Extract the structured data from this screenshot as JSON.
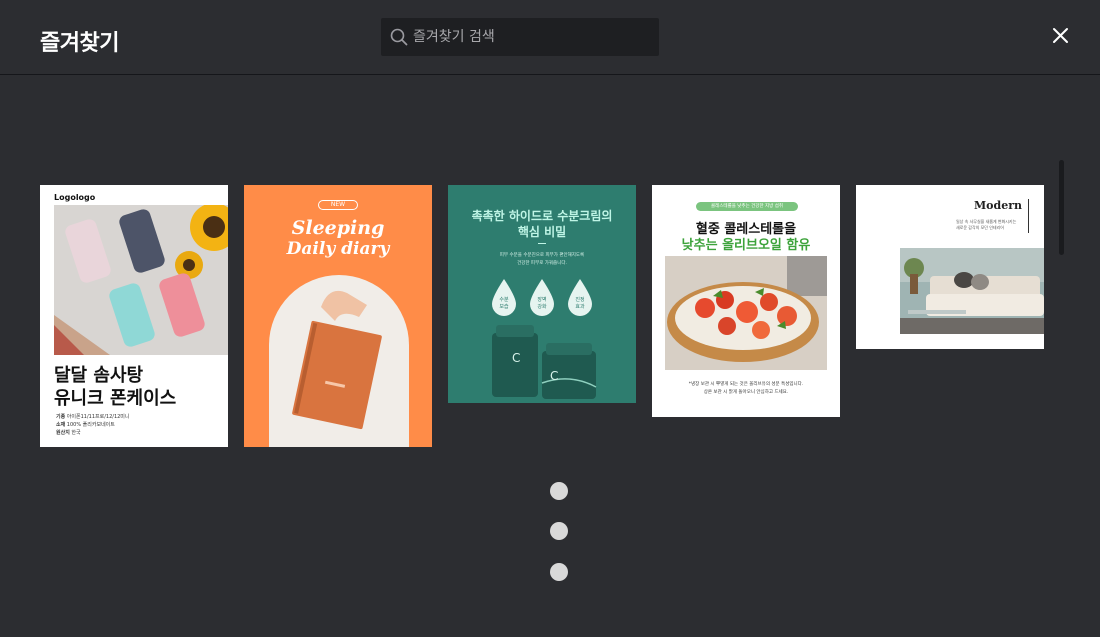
{
  "header": {
    "title": "즐겨찾기",
    "search_placeholder": "즐겨찾기 검색"
  },
  "icons": {
    "search": "search-icon",
    "close": "close-icon",
    "more": "more-vertical-icon"
  },
  "cards": [
    {
      "logo": "Logologo",
      "headline_line1": "달달 솜사탕",
      "headline_line2": "유니크 폰케이스",
      "spec1_label": "기종",
      "spec1_value": "아이폰11/11프로/12/12미니",
      "spec2_label": "소재",
      "spec2_value": "100% 폴리카보네이트",
      "spec3_label": "원산지",
      "spec3_value": "한국"
    },
    {
      "badge": "NEW",
      "title_line1": "Sleeping",
      "title_line2": "Daily diary"
    },
    {
      "headline_line1": "촉촉한 하이드로 수분크림의",
      "headline_line2": "핵심 비밀",
      "body_line1": "피부 수분을 수분진으로 피부가 편안해지도록",
      "body_line2": "건강한 피부로 가꿔줍니다.",
      "drops": [
        {
          "line1": "수분",
          "line2": "보습"
        },
        {
          "line1": "장벽",
          "line2": "강화"
        },
        {
          "line1": "진정",
          "line2": "효과"
        }
      ],
      "jar_letter": "C"
    },
    {
      "tag": "콜레스테롤을 낮추는 건강한 지방 섭취",
      "headline_line1": "혈중 콜레스테롤을",
      "headline_line2": "낮추는 올리브오일 함유",
      "body_line1": "*냉장 보관 시 뿌옇게 되는 것은 올리브유의 성분 특성입니다.",
      "body_line2": "상온 보관 시 맑게 돌아오니 안심하고 드세요."
    },
    {
      "title": "Modern",
      "body_line1": "일상 속 사무실을 새롭게 변화시키는",
      "body_line2": "새로운 감각의 모던 인테리어"
    }
  ],
  "colors": {
    "background": "#2c2d31",
    "search_bg": "#1e1f22",
    "card_orange": "#ff8c48",
    "card_teal": "#2e7d6f",
    "accent_green": "#4caf50",
    "dot": "#d9d9d9"
  }
}
